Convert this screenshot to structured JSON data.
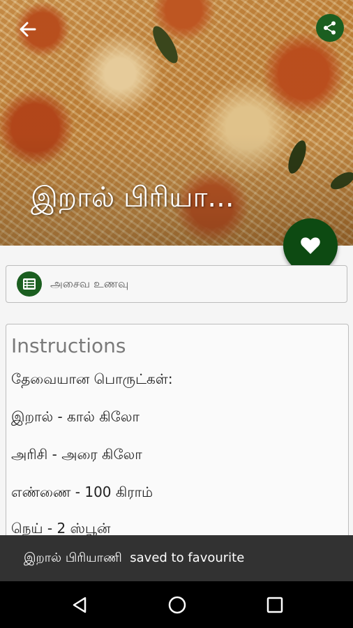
{
  "header": {
    "title": "இறால் பிரியா...",
    "back_icon": "arrow-back-icon",
    "share_icon": "share-icon",
    "favorite_icon": "heart-icon"
  },
  "category": {
    "label": "அசைவ உணவு",
    "icon": "list-icon"
  },
  "instructions": {
    "heading": "Instructions",
    "lines": [
      "தேவையான பொருட்கள்:",
      "இறால் - கால் கிலோ",
      "அரிசி - அரை கிலோ",
      "எண்ணை - 100 கிராம்",
      "நெய் - 2 ஸ்பூன்"
    ]
  },
  "snackbar": {
    "message": "இறால் பிரியாணி  saved to favourite"
  },
  "navigation": {
    "back_icon": "nav-back-icon",
    "home_icon": "nav-home-icon",
    "recents_icon": "nav-recents-icon"
  },
  "colors": {
    "accent": "#1b5e20",
    "fab": "#0d4a12",
    "snackbar": "#323232"
  }
}
